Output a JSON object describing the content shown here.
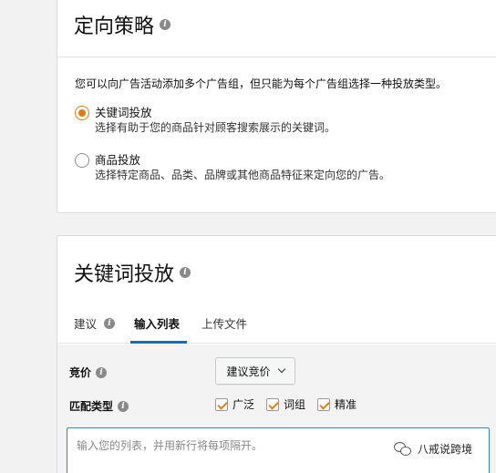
{
  "targeting": {
    "title": "定向策略",
    "description": "您可以向广告活动添加多个广告组，但只能为每个广告组选择一种投放类型。",
    "options": [
      {
        "label": "关键词投放",
        "sub": "选择有助于您的商品针对顾客搜索展示的关键词。",
        "checked": true
      },
      {
        "label": "商品投放",
        "sub": "选择特定商品、品类、品牌或其他商品特征来定向您的广告。",
        "checked": false
      }
    ]
  },
  "keyword": {
    "title": "关键词投放",
    "tabs": [
      {
        "label": "建议",
        "active": false
      },
      {
        "label": "输入列表",
        "active": true
      },
      {
        "label": "上传文件",
        "active": false
      }
    ],
    "bid_label": "竞价",
    "bid_dropdown": "建议竞价",
    "match_label": "匹配类型",
    "match_types": [
      {
        "label": "广泛",
        "checked": true
      },
      {
        "label": "词组",
        "checked": true
      },
      {
        "label": "精准",
        "checked": true
      }
    ],
    "textarea_placeholder": "输入您的列表，并用新行将每项隔开。"
  },
  "watermark": "八戒说跨境",
  "colors": {
    "accent": "#e47911",
    "tab_active": "#146eb4",
    "focus": "#2b88c8"
  },
  "icons": {
    "info": "info-icon",
    "chevron": "chevron-down-icon",
    "watermark": "wechat-icon"
  }
}
